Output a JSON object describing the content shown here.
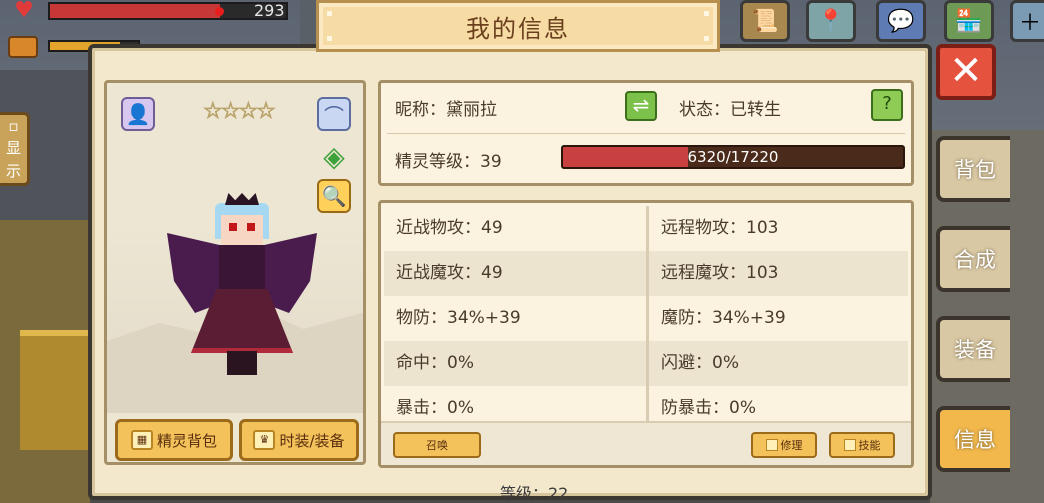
{
  "hud": {
    "hp_value": "293",
    "hp_fraction": 0.72,
    "hunger_fraction": 0.8
  },
  "side_show": {
    "label_1": "显",
    "label_2": "示"
  },
  "window": {
    "title": "我的信息",
    "close_glyph": "✕"
  },
  "character": {
    "stars": "☆☆☆☆",
    "pet_bag_label": "精灵背包",
    "costume_label": "时装/装备"
  },
  "info": {
    "nickname": "昵称：黛丽拉",
    "state": "状态：已转生",
    "level": "精灵等级：39",
    "exp_text": "6320/17220",
    "exp_current": 6320,
    "exp_max": 17220,
    "swap_glyph": "⇌",
    "help_glyph": "?"
  },
  "stats": {
    "rows": [
      {
        "left": "近战物攻：49",
        "right": "远程物攻：103"
      },
      {
        "left": "近战魔攻：49",
        "right": "远程魔攻：103"
      },
      {
        "left": "物防：34%+39",
        "right": "魔防：34%+39"
      },
      {
        "left": "命中：0%",
        "right": "闪避：0%"
      },
      {
        "left": "暴击：0%",
        "right": "防暴击：0%"
      }
    ],
    "summon_label": "召唤",
    "repair_label": "修理",
    "skill_label": "技能"
  },
  "side_menu": {
    "bag": "背包",
    "craft": "合成",
    "equip": "装备",
    "info": "信息"
  },
  "bottom_text": "等级：22",
  "colors": {
    "exp_fill": "#c94040",
    "hp_fill": "#c83737",
    "accent_button": "#f3c25a",
    "close_button": "#e5533f"
  }
}
